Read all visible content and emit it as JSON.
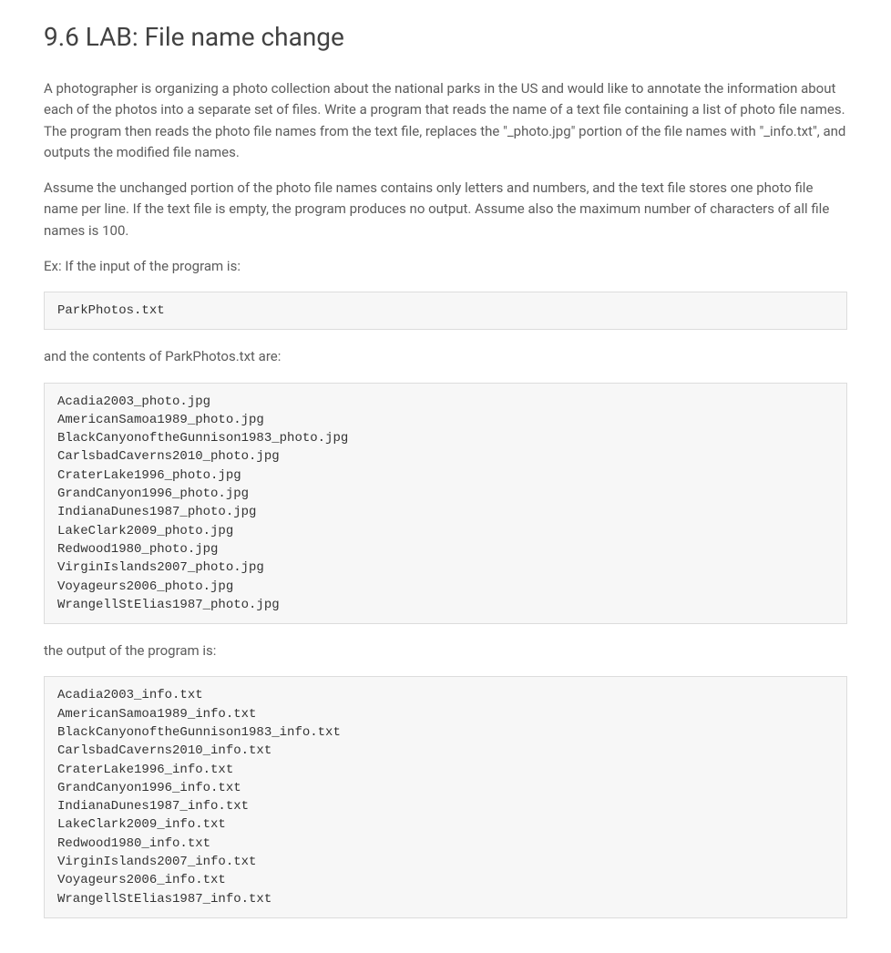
{
  "title": "9.6 LAB: File name change",
  "paragraphs": {
    "p1": "A photographer is organizing a photo collection about the national parks in the US and would like to annotate the information about each of the photos into a separate set of files. Write a program that reads the name of a text file containing a list of photo file names. The program then reads the photo file names from the text file, replaces the \"_photo.jpg\" portion of the file names with \"_info.txt\", and outputs the modified file names.",
    "p2": "Assume the unchanged portion of the photo file names contains only letters and numbers, and the text file stores one photo file name per line. If the text file is empty, the program produces no output. Assume also the maximum number of characters of all file names is 100.",
    "p3": "Ex: If the input of the program is:",
    "p4": "and the contents of ParkPhotos.txt are:",
    "p5": "the output of the program is:"
  },
  "code": {
    "input_filename": "ParkPhotos.txt",
    "input_contents": "Acadia2003_photo.jpg\nAmericanSamoa1989_photo.jpg\nBlackCanyonoftheGunnison1983_photo.jpg\nCarlsbadCaverns2010_photo.jpg\nCraterLake1996_photo.jpg\nGrandCanyon1996_photo.jpg\nIndianaDunes1987_photo.jpg\nLakeClark2009_photo.jpg\nRedwood1980_photo.jpg\nVirginIslands2007_photo.jpg\nVoyageurs2006_photo.jpg\nWrangellStElias1987_photo.jpg",
    "output_contents": "Acadia2003_info.txt\nAmericanSamoa1989_info.txt\nBlackCanyonoftheGunnison1983_info.txt\nCarlsbadCaverns2010_info.txt\nCraterLake1996_info.txt\nGrandCanyon1996_info.txt\nIndianaDunes1987_info.txt\nLakeClark2009_info.txt\nRedwood1980_info.txt\nVirginIslands2007_info.txt\nVoyageurs2006_info.txt\nWrangellStElias1987_info.txt"
  }
}
